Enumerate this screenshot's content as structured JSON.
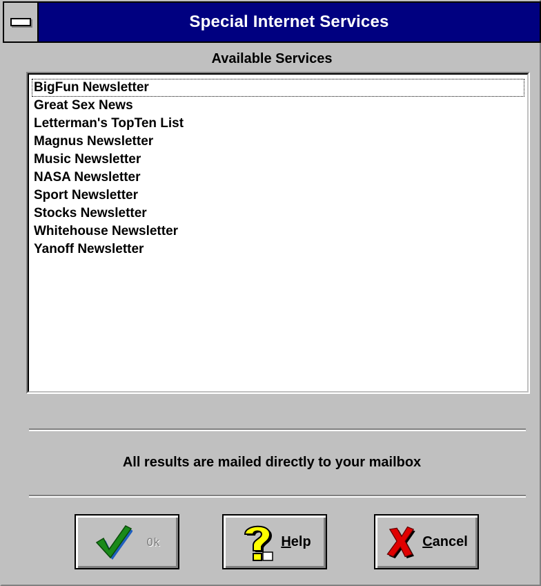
{
  "window": {
    "title": "Special Internet Services"
  },
  "services": {
    "heading": "Available Services",
    "items": [
      "BigFun Newsletter",
      "Great Sex News",
      "Letterman's TopTen List",
      "Magnus Newsletter",
      "Music Newsletter",
      "NASA Newsletter",
      "Sport Newsletter",
      "Stocks Newsletter",
      "Whitehouse Newsletter",
      "Yanoff Newsletter"
    ],
    "focused_index": 0
  },
  "info": {
    "message": "All results are mailed directly to your mailbox"
  },
  "buttons": {
    "ok": {
      "label": "Ok",
      "enabled": false,
      "icon": "checkmark-icon"
    },
    "help": {
      "mnemonic": "H",
      "rest": "elp",
      "icon": "question-mark-icon"
    },
    "cancel": {
      "mnemonic": "C",
      "rest": "ancel",
      "icon": "red-x-icon"
    }
  },
  "colors": {
    "titlebar": "#000080",
    "face": "#c0c0c0",
    "check_green": "#1a8a1a",
    "help_yellow": "#ffff00",
    "cancel_red": "#e00000"
  }
}
